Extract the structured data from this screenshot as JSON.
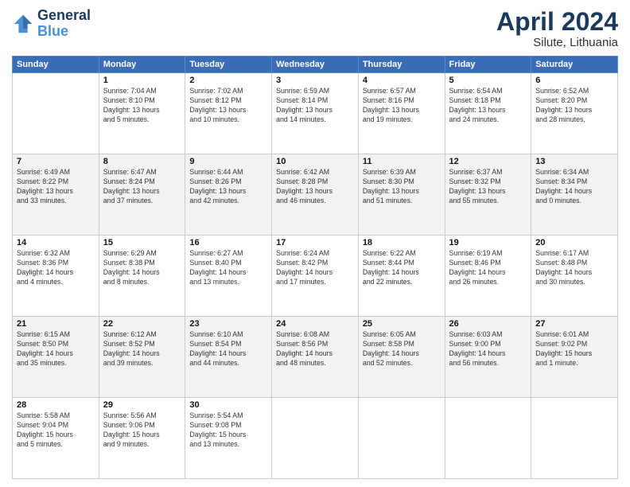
{
  "header": {
    "logo_line1": "General",
    "logo_line2": "Blue",
    "month": "April 2024",
    "location": "Silute, Lithuania"
  },
  "weekdays": [
    "Sunday",
    "Monday",
    "Tuesday",
    "Wednesday",
    "Thursday",
    "Friday",
    "Saturday"
  ],
  "weeks": [
    [
      {
        "day": "",
        "info": ""
      },
      {
        "day": "1",
        "info": "Sunrise: 7:04 AM\nSunset: 8:10 PM\nDaylight: 13 hours\nand 5 minutes."
      },
      {
        "day": "2",
        "info": "Sunrise: 7:02 AM\nSunset: 8:12 PM\nDaylight: 13 hours\nand 10 minutes."
      },
      {
        "day": "3",
        "info": "Sunrise: 6:59 AM\nSunset: 8:14 PM\nDaylight: 13 hours\nand 14 minutes."
      },
      {
        "day": "4",
        "info": "Sunrise: 6:57 AM\nSunset: 8:16 PM\nDaylight: 13 hours\nand 19 minutes."
      },
      {
        "day": "5",
        "info": "Sunrise: 6:54 AM\nSunset: 8:18 PM\nDaylight: 13 hours\nand 24 minutes."
      },
      {
        "day": "6",
        "info": "Sunrise: 6:52 AM\nSunset: 8:20 PM\nDaylight: 13 hours\nand 28 minutes."
      }
    ],
    [
      {
        "day": "7",
        "info": "Sunrise: 6:49 AM\nSunset: 8:22 PM\nDaylight: 13 hours\nand 33 minutes."
      },
      {
        "day": "8",
        "info": "Sunrise: 6:47 AM\nSunset: 8:24 PM\nDaylight: 13 hours\nand 37 minutes."
      },
      {
        "day": "9",
        "info": "Sunrise: 6:44 AM\nSunset: 8:26 PM\nDaylight: 13 hours\nand 42 minutes."
      },
      {
        "day": "10",
        "info": "Sunrise: 6:42 AM\nSunset: 8:28 PM\nDaylight: 13 hours\nand 46 minutes."
      },
      {
        "day": "11",
        "info": "Sunrise: 6:39 AM\nSunset: 8:30 PM\nDaylight: 13 hours\nand 51 minutes."
      },
      {
        "day": "12",
        "info": "Sunrise: 6:37 AM\nSunset: 8:32 PM\nDaylight: 13 hours\nand 55 minutes."
      },
      {
        "day": "13",
        "info": "Sunrise: 6:34 AM\nSunset: 8:34 PM\nDaylight: 14 hours\nand 0 minutes."
      }
    ],
    [
      {
        "day": "14",
        "info": "Sunrise: 6:32 AM\nSunset: 8:36 PM\nDaylight: 14 hours\nand 4 minutes."
      },
      {
        "day": "15",
        "info": "Sunrise: 6:29 AM\nSunset: 8:38 PM\nDaylight: 14 hours\nand 8 minutes."
      },
      {
        "day": "16",
        "info": "Sunrise: 6:27 AM\nSunset: 8:40 PM\nDaylight: 14 hours\nand 13 minutes."
      },
      {
        "day": "17",
        "info": "Sunrise: 6:24 AM\nSunset: 8:42 PM\nDaylight: 14 hours\nand 17 minutes."
      },
      {
        "day": "18",
        "info": "Sunrise: 6:22 AM\nSunset: 8:44 PM\nDaylight: 14 hours\nand 22 minutes."
      },
      {
        "day": "19",
        "info": "Sunrise: 6:19 AM\nSunset: 8:46 PM\nDaylight: 14 hours\nand 26 minutes."
      },
      {
        "day": "20",
        "info": "Sunrise: 6:17 AM\nSunset: 8:48 PM\nDaylight: 14 hours\nand 30 minutes."
      }
    ],
    [
      {
        "day": "21",
        "info": "Sunrise: 6:15 AM\nSunset: 8:50 PM\nDaylight: 14 hours\nand 35 minutes."
      },
      {
        "day": "22",
        "info": "Sunrise: 6:12 AM\nSunset: 8:52 PM\nDaylight: 14 hours\nand 39 minutes."
      },
      {
        "day": "23",
        "info": "Sunrise: 6:10 AM\nSunset: 8:54 PM\nDaylight: 14 hours\nand 44 minutes."
      },
      {
        "day": "24",
        "info": "Sunrise: 6:08 AM\nSunset: 8:56 PM\nDaylight: 14 hours\nand 48 minutes."
      },
      {
        "day": "25",
        "info": "Sunrise: 6:05 AM\nSunset: 8:58 PM\nDaylight: 14 hours\nand 52 minutes."
      },
      {
        "day": "26",
        "info": "Sunrise: 6:03 AM\nSunset: 9:00 PM\nDaylight: 14 hours\nand 56 minutes."
      },
      {
        "day": "27",
        "info": "Sunrise: 6:01 AM\nSunset: 9:02 PM\nDaylight: 15 hours\nand 1 minute."
      }
    ],
    [
      {
        "day": "28",
        "info": "Sunrise: 5:58 AM\nSunset: 9:04 PM\nDaylight: 15 hours\nand 5 minutes."
      },
      {
        "day": "29",
        "info": "Sunrise: 5:56 AM\nSunset: 9:06 PM\nDaylight: 15 hours\nand 9 minutes."
      },
      {
        "day": "30",
        "info": "Sunrise: 5:54 AM\nSunset: 9:08 PM\nDaylight: 15 hours\nand 13 minutes."
      },
      {
        "day": "",
        "info": ""
      },
      {
        "day": "",
        "info": ""
      },
      {
        "day": "",
        "info": ""
      },
      {
        "day": "",
        "info": ""
      }
    ]
  ]
}
